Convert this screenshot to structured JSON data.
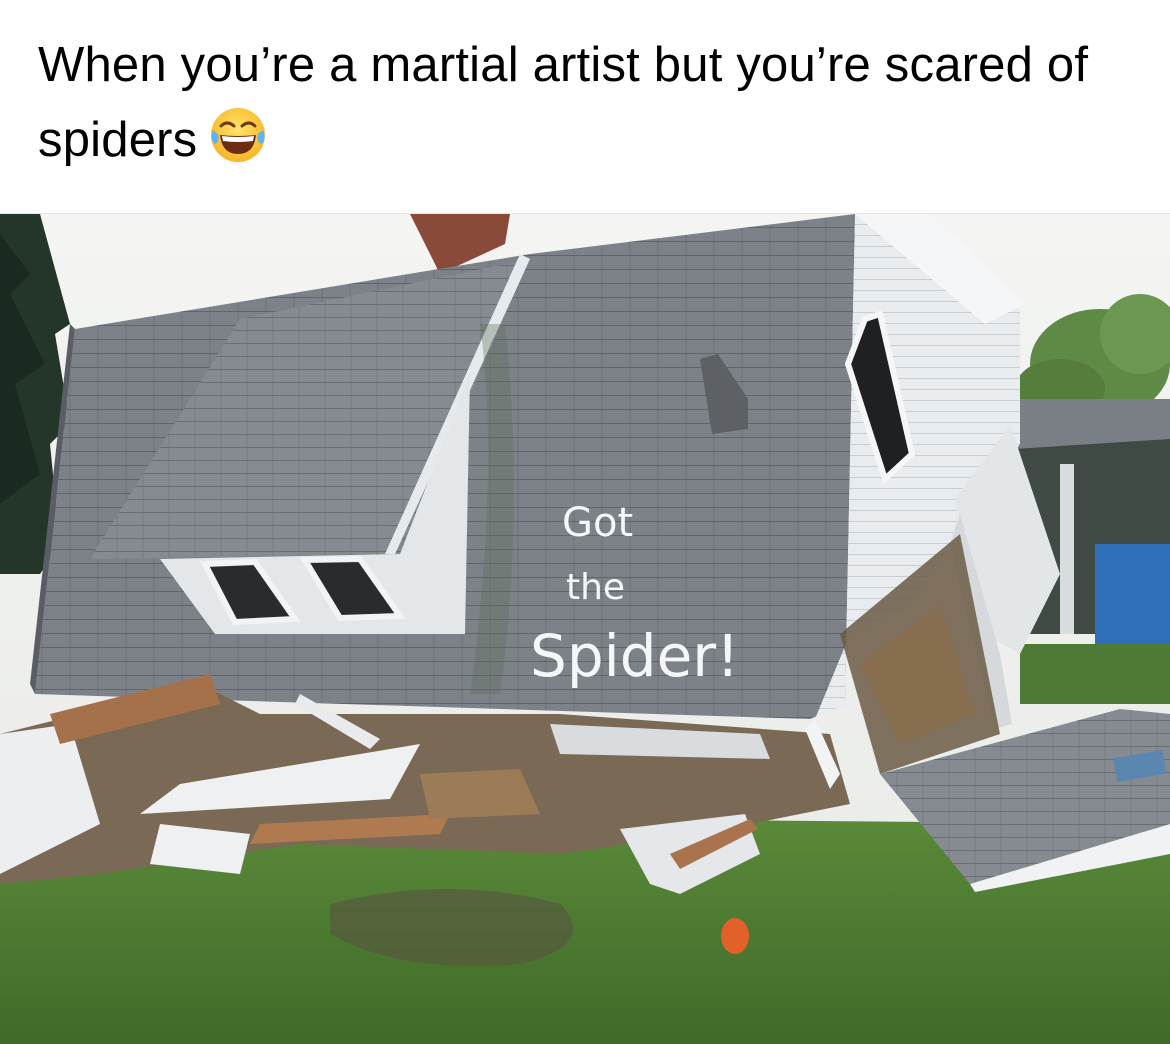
{
  "post": {
    "caption_text": "When you’re a martial artist but you’re scared of spiders",
    "caption_emoji": "face-with-tears-of-joy-emoji"
  },
  "photo": {
    "subject": "collapsed-house",
    "graffiti": {
      "line1": "Got",
      "line2": "the",
      "line3": "Spider!"
    },
    "colors": {
      "sky": "#f2f3f1",
      "roof": "#7b8087",
      "siding": "#eceef0",
      "grass": "#4f7a34",
      "chimney": "#8a4a3a"
    }
  }
}
